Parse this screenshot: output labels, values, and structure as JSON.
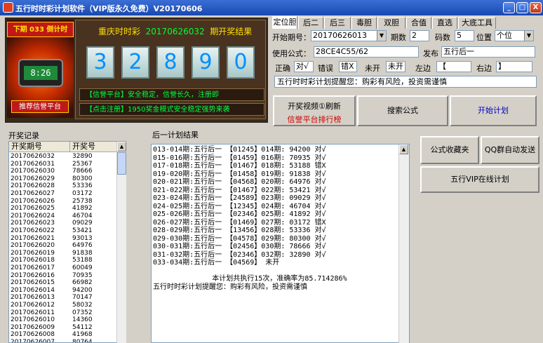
{
  "window": {
    "title": "五行时时彩计划软件（VIP版永久免费）V20170606",
    "min": "_",
    "max": "□",
    "close": "X"
  },
  "banner": {
    "period_header": "下期 033 倒计时",
    "countdown": "8:26",
    "trust_button": "推荐信誉平台",
    "draw_title_prefix": "重庆时时彩",
    "draw_date": "20170626032",
    "draw_title_suffix": "期开奖结果",
    "balls": [
      "3",
      "2",
      "8",
      "9",
      "0"
    ],
    "notice1": "【信誉平台】安全稳定，信誉长久，注册即",
    "notice2": "【点击注册】1950奖金模式安全稳定强势来袭"
  },
  "tabs": [
    "定位胆",
    "后二",
    "后三",
    "毒胆",
    "双胆",
    "合值",
    "直选",
    "大底工具"
  ],
  "form": {
    "start_period_label": "开始期号：",
    "start_period_value": "20170626013",
    "periods_label": "期数",
    "periods_value": "2",
    "code_count_label": "码数",
    "code_count_value": "5",
    "position_label": "位置",
    "position_value": "个位",
    "formula_label": "使用公式：",
    "formula_value": "28CE4C55/62",
    "publish_label": "发布",
    "publish_value": "五行后一",
    "correct_label": "正确",
    "correct_value": "对√",
    "wrong_label": "错误",
    "wrong_value": "错X",
    "pending_label": "未开",
    "pending_value": "未开",
    "left_label": "左边",
    "left_value": "【",
    "right_label": "右边",
    "right_value": "】",
    "message": "五行时时彩计划提醒您：购彩有风险，投资需谨慎"
  },
  "buttons": {
    "video_refresh": "开奖视频①刷新",
    "trust_rank": "信誉平台排行榜",
    "search_formula": "搜索公式",
    "start_plan": "开始计划",
    "formula_fav": "公式收藏夹",
    "qq_send": "QQ群自动发送",
    "vip_online": "五行VIP在线计划"
  },
  "history": {
    "label": "开奖记录",
    "col_period": "开奖期号",
    "col_number": "开奖号",
    "rows": [
      [
        "20170626032",
        "32890"
      ],
      [
        "20170626031",
        "25367"
      ],
      [
        "20170626030",
        "78666"
      ],
      [
        "20170626029",
        "80300"
      ],
      [
        "20170626028",
        "53336"
      ],
      [
        "20170626027",
        "03172"
      ],
      [
        "20170626026",
        "25738"
      ],
      [
        "20170626025",
        "41892"
      ],
      [
        "20170626024",
        "46704"
      ],
      [
        "20170626023",
        "09029"
      ],
      [
        "20170626022",
        "53421"
      ],
      [
        "20170626021",
        "93013"
      ],
      [
        "20170626020",
        "64976"
      ],
      [
        "20170626019",
        "91838"
      ],
      [
        "20170626018",
        "53188"
      ],
      [
        "20170626017",
        "60049"
      ],
      [
        "20170626016",
        "70935"
      ],
      [
        "20170626015",
        "66982"
      ],
      [
        "20170626014",
        "94200"
      ],
      [
        "20170626013",
        "70147"
      ],
      [
        "20170626012",
        "58032"
      ],
      [
        "20170626011",
        "07352"
      ],
      [
        "20170626010",
        "14360"
      ],
      [
        "20170626009",
        "54112"
      ],
      [
        "20170626008",
        "41968"
      ],
      [
        "20170626007",
        "80764"
      ]
    ]
  },
  "plan": {
    "label": "后一计划结果",
    "lines": [
      "013-014期:五行后一 【01245】014期: 94200 对√",
      "015-016期:五行后一 【01459】016期: 70935 对√",
      "017-018期:五行后一 【01467】018期: 53188 错X",
      "019-020期:五行后一 【01458】019期: 91838 对√",
      "020-021期:五行后一 【04568】020期: 64976 对√",
      "021-022期:五行后一 【01467】022期: 53421 对√",
      "023-024期:五行后一 【24589】023期: 09029 对√",
      "024-025期:五行后一 【12345】024期: 46704 对√",
      "025-026期:五行后一 【02346】025期: 41892 对√",
      "026-027期:五行后一 【01469】027期: 03172 错X",
      "028-029期:五行后一 【13456】028期: 53336 对√",
      "029-030期:五行后一 【04578】029期: 80300 对√",
      "030-031期:五行后一 【02456】030期: 78666 对√",
      "031-032期:五行后一 【02346】032期: 32890 对√",
      "033-034期:五行后一 【04569】 未开",
      "",
      "              本计划共执行15次，准确率为85.714286%",
      "五行时时彩计划提醒您：购彩有风险，投资需谨慎"
    ]
  }
}
